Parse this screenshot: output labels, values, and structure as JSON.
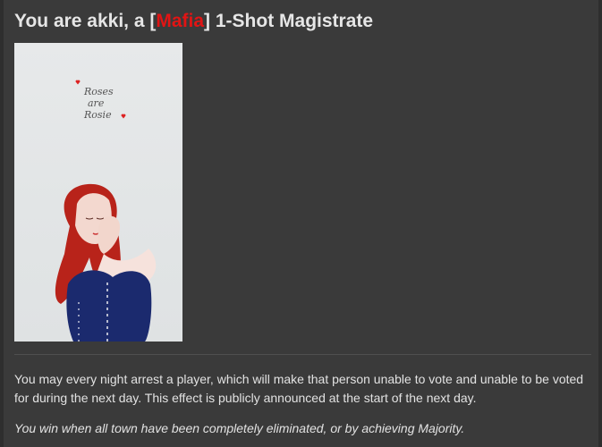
{
  "post": {
    "title_prefix": "You are akki, a [",
    "title_faction": "Mafia",
    "title_suffix": "] 1-Shot Magistrate",
    "faction_color": "#e11414",
    "image": {
      "line1": "Roses",
      "line2": "are",
      "line3": "Rosie"
    },
    "description": "You may every night arrest a player, which will make that person unable to vote and unable to be voted for during the next day. This effect is publicly announced at the start of the next day.",
    "win_condition": "You win when all town have been completely eliminated, or by achieving Majority."
  }
}
